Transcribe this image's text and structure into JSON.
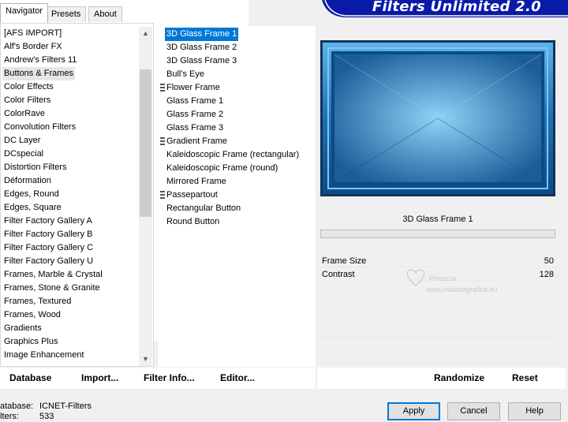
{
  "tabs": [
    {
      "label": "Navigator",
      "active": true
    },
    {
      "label": "Presets",
      "active": false
    },
    {
      "label": "About",
      "active": false
    }
  ],
  "banner_title": "Filters Unlimited 2.0",
  "categories": [
    "[AFS IMPORT]",
    "Alf's Border FX",
    "Andrew's Filters 11",
    "Buttons & Frames",
    "Color Effects",
    "Color Filters",
    "ColorRave",
    "Convolution Filters",
    "DC Layer",
    "DCspecial",
    "Distortion Filters",
    "Déformation",
    "Edges, Round",
    "Edges, Square",
    "Filter Factory Gallery A",
    "Filter Factory Gallery B",
    "Filter Factory Gallery C",
    "Filter Factory Gallery U",
    "Frames, Marble & Crystal",
    "Frames, Stone & Granite",
    "Frames, Textured",
    "Frames, Wood",
    "Gradients",
    "Graphics Plus",
    "Image Enhancement"
  ],
  "selected_category_index": 3,
  "filters": [
    {
      "label": "3D Glass Frame 1",
      "marker": false
    },
    {
      "label": "3D Glass Frame 2",
      "marker": false
    },
    {
      "label": "3D Glass Frame 3",
      "marker": false
    },
    {
      "label": "Bull's Eye",
      "marker": false
    },
    {
      "label": "Flower Frame",
      "marker": true
    },
    {
      "label": "Glass Frame 1",
      "marker": false
    },
    {
      "label": "Glass Frame 2",
      "marker": false
    },
    {
      "label": "Glass Frame 3",
      "marker": false
    },
    {
      "label": "Gradient Frame",
      "marker": true
    },
    {
      "label": "Kaleidoscopic Frame (rectangular)",
      "marker": false
    },
    {
      "label": "Kaleidoscopic Frame (round)",
      "marker": false
    },
    {
      "label": "Mirrored Frame",
      "marker": false
    },
    {
      "label": "Passepartout",
      "marker": true
    },
    {
      "label": "Rectangular Button",
      "marker": false
    },
    {
      "label": "Round Button",
      "marker": false
    }
  ],
  "selected_filter_index": 0,
  "preview": {
    "filter_name": "3D Glass Frame 1",
    "progress": 0,
    "colors": {
      "frame": "#1e6fb3",
      "center": "#8fd4f7",
      "edge": "#1a5d99"
    }
  },
  "parameters": [
    {
      "label": "Frame Size",
      "value": "50"
    },
    {
      "label": "Contrast",
      "value": "128"
    }
  ],
  "watermark": {
    "line1": "Pinuccia",
    "line2": "www.maldiragrafica.eu"
  },
  "toolbar": {
    "database": "Database",
    "import": "Import...",
    "filter_info": "Filter Info...",
    "editor": "Editor...",
    "randomize": "Randomize",
    "reset": "Reset"
  },
  "status": {
    "database_label": "atabase:",
    "database_value": "ICNET-Filters",
    "filters_label": "lters:",
    "filters_value": "533"
  },
  "buttons": {
    "apply": "Apply",
    "cancel": "Cancel",
    "help": "Help"
  }
}
